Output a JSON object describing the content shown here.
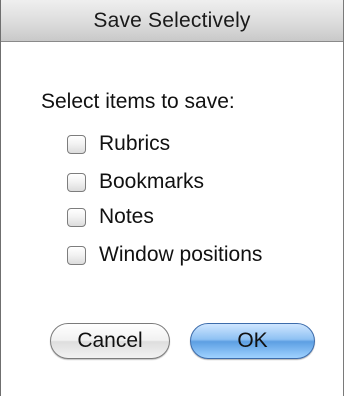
{
  "window": {
    "title": "Save Selectively"
  },
  "prompt": "Select items to save:",
  "options": [
    {
      "label": "Rubrics",
      "checked": false
    },
    {
      "label": "Bookmarks",
      "checked": false
    },
    {
      "label": "Notes",
      "checked": false
    },
    {
      "label": "Window positions",
      "checked": false
    }
  ],
  "buttons": {
    "cancel": "Cancel",
    "ok": "OK"
  },
  "colors": {
    "default_button": "#5d9fe3"
  }
}
